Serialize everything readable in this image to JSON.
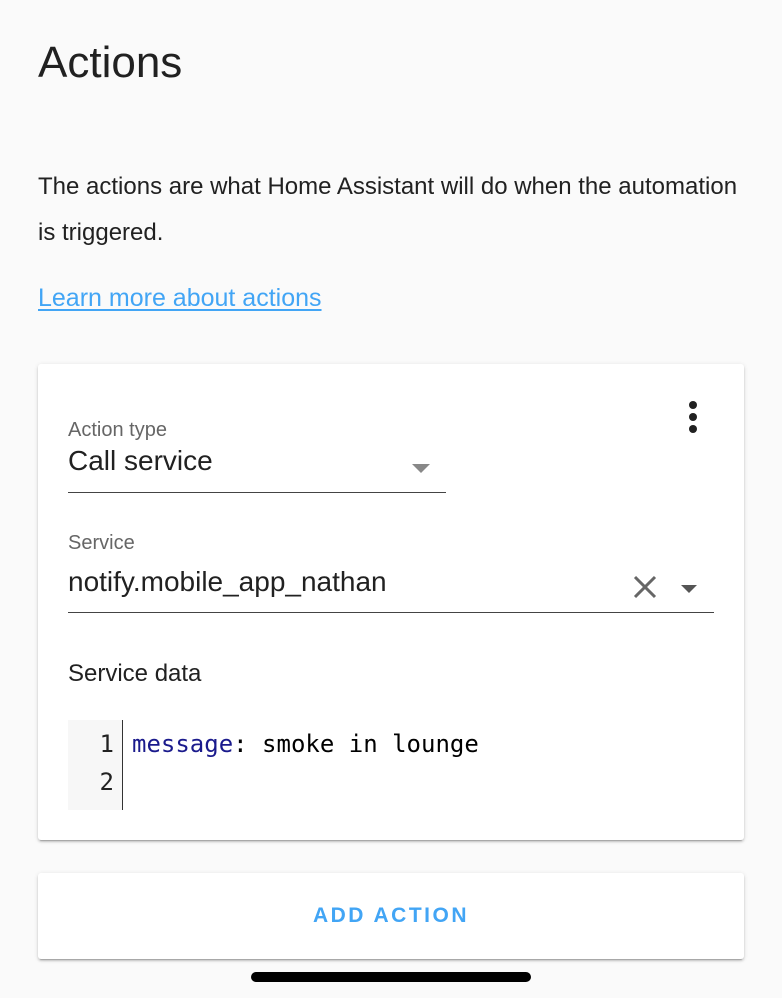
{
  "section": {
    "title": "Actions",
    "description": "The actions are what Home Assistant will do when the automation is triggered.",
    "learn_more_link": "Learn more about actions"
  },
  "action_card": {
    "menu_icon": "dots-vertical-icon",
    "action_type": {
      "label": "Action type",
      "value": "Call service",
      "icon": "chevron-down-icon"
    },
    "service": {
      "label": "Service",
      "value": "notify.mobile_app_nathan",
      "clear_icon": "close-icon",
      "dropdown_icon": "chevron-down-icon"
    },
    "service_data": {
      "label": "Service data",
      "line_numbers": [
        "1",
        "2"
      ],
      "lines": [
        {
          "key": "message",
          "separator": ":",
          "value": " smoke in lounge"
        },
        {
          "key": "",
          "separator": "",
          "value": ""
        }
      ]
    }
  },
  "add_action": {
    "label": "ADD ACTION"
  },
  "colors": {
    "accent": "#42a5f5",
    "background": "#fafafa",
    "card": "#ffffff",
    "text": "#212121",
    "secondary_text": "#666666",
    "yaml_key": "#1a1a8c"
  }
}
